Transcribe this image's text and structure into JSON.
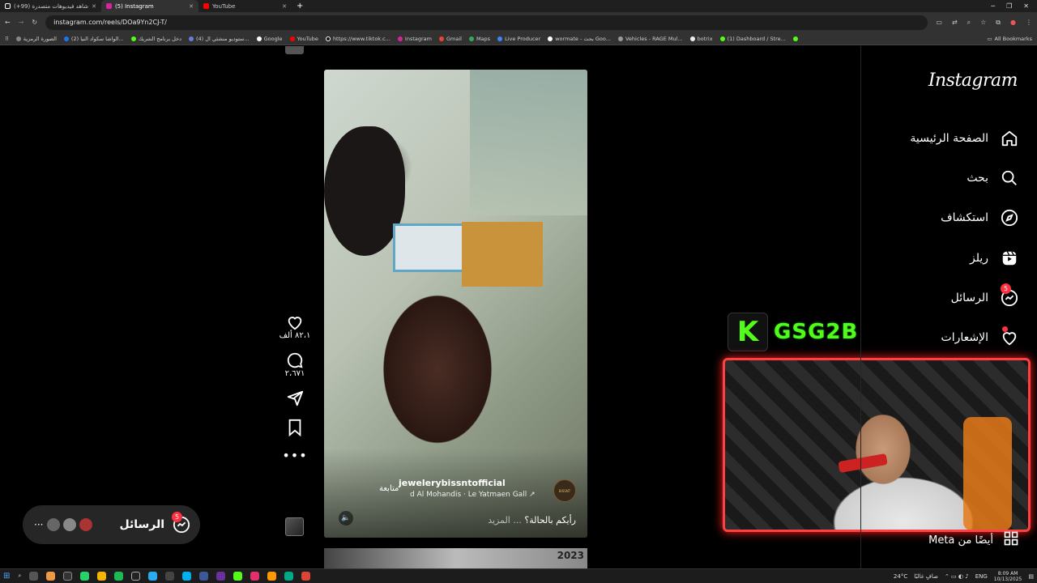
{
  "browser": {
    "tabs": [
      {
        "label": "(+99) شاهد فيديوهات متصدرة",
        "active": false
      },
      {
        "label": "(5) Instagram",
        "active": true
      },
      {
        "label": "YouTube",
        "active": false
      }
    ],
    "new_tab": "+",
    "url": "instagram.com/reels/DOa9Yn2CJ-T/",
    "bookmarks": [
      "الصورة الرمزية",
      "(2) الواشا سكواد النيا...",
      "دخل برنامج الشريك",
      "(4) ستوديو منشئي ال...",
      "Google",
      "YouTube",
      "https://www.tiktok.c...",
      "Instagram",
      "Gmail",
      "Maps",
      "Live Producer",
      "wormate - بحث Goo...",
      "Vehicles - RAGE Mul...",
      "botrix",
      "(1) Dashboard / Stre..."
    ],
    "all_bookmarks": "All Bookmarks"
  },
  "sidebar": {
    "logo": "Instagram",
    "items": [
      {
        "label": "الصفحة الرئيسية",
        "icon": "home-icon"
      },
      {
        "label": "بحث",
        "icon": "search-icon"
      },
      {
        "label": "استكشاف",
        "icon": "compass-icon"
      },
      {
        "label": "ريلز",
        "icon": "reels-icon"
      },
      {
        "label": "الرسائل",
        "icon": "messenger-icon",
        "badge": "5"
      },
      {
        "label": "الإشعارات",
        "icon": "heart-icon"
      }
    ],
    "meta": "أيضًا من Meta"
  },
  "reel": {
    "author": "jewelerybissntofficial",
    "follow": "متابعة",
    "audio": "d Al Mohandis · Le Yatmaen Gall ↗",
    "avatar_text": "BISSNT",
    "caption": "رأيكم بالحالة؟",
    "more": "... المزيد",
    "next_label": "2023"
  },
  "actions": {
    "likes": "٨٢،١ ألف",
    "comments": "٢،٦٧١"
  },
  "messages_pill": {
    "label": "الرسائل",
    "badge": "5",
    "more": "···"
  },
  "overlay": {
    "k_logo": "K",
    "channel": "GSG2B"
  },
  "taskbar": {
    "weather": "24°C",
    "weather_text": "صافٍ غالبًا",
    "lang": "ENG",
    "time": "8:09 AM",
    "date": "10/13/2025"
  }
}
